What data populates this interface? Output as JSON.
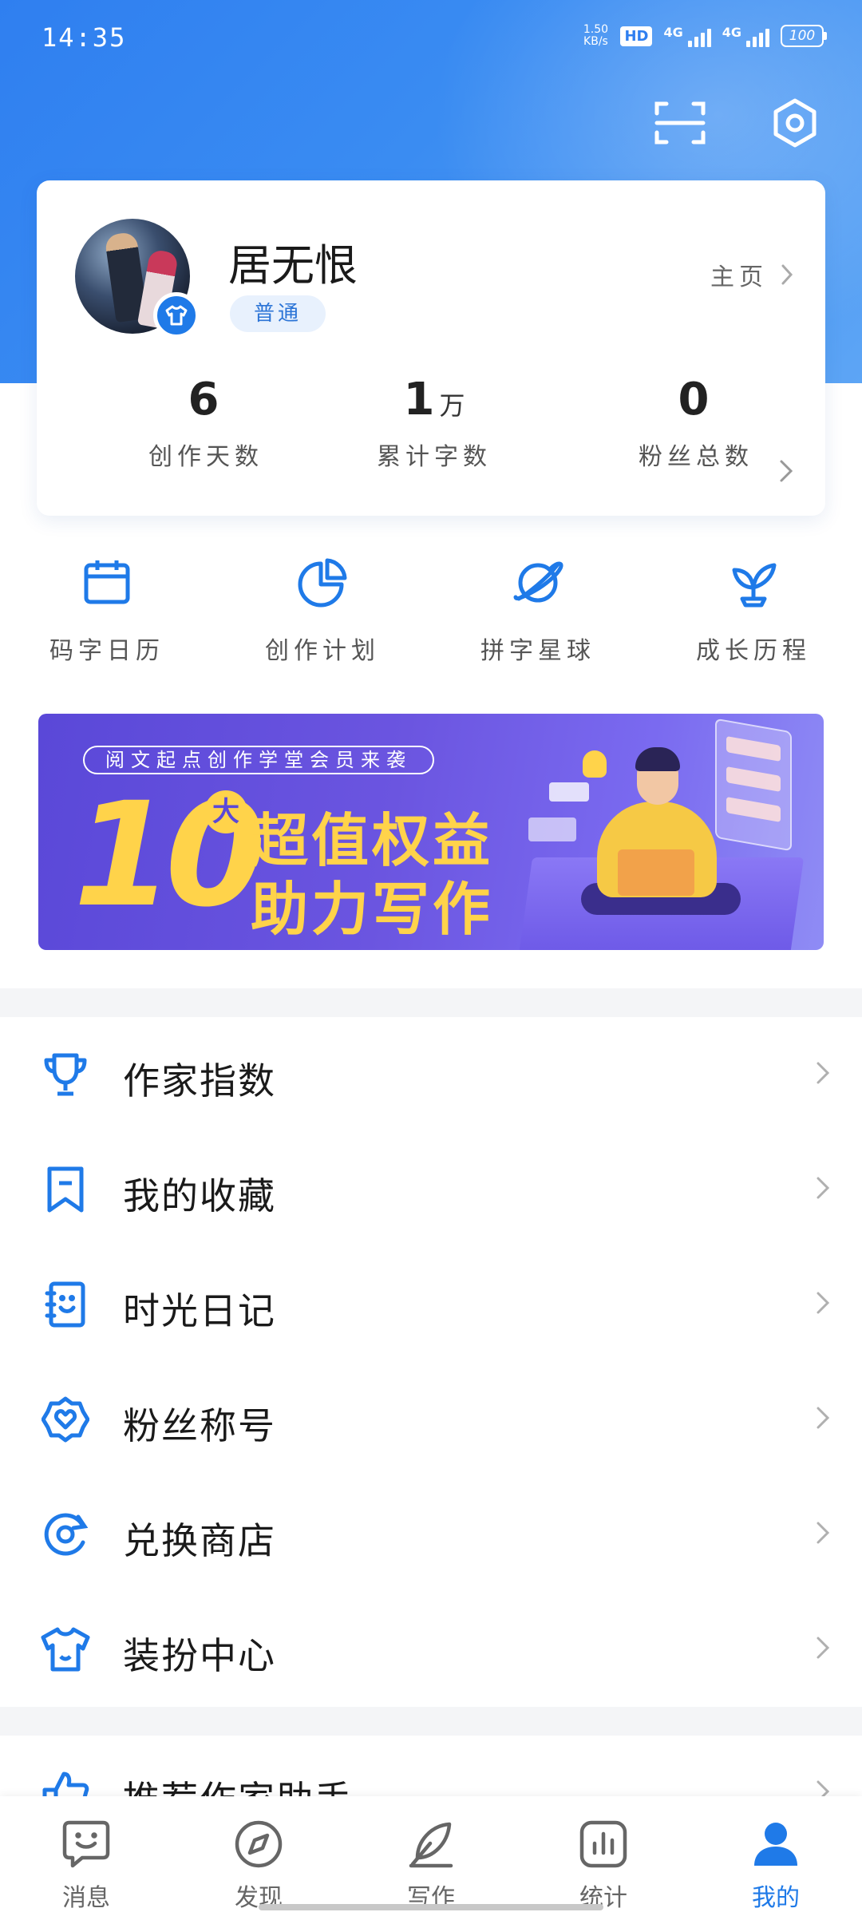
{
  "status_bar": {
    "time": "14:35",
    "net_speed_value": "1.50",
    "net_speed_unit": "KB/s",
    "hd_label": "HD",
    "sim1_label": "4G",
    "sim2_label": "4G",
    "battery": "100"
  },
  "header": {
    "icons": [
      "scan-icon",
      "settings-icon"
    ]
  },
  "profile": {
    "username": "居无恨",
    "level": "普通",
    "homepage_label": "主页",
    "stats": [
      {
        "value": "6",
        "unit": "",
        "label": "创作天数"
      },
      {
        "value": "1",
        "unit": "万",
        "label": "累计字数"
      },
      {
        "value": "0",
        "unit": "",
        "label": "粉丝总数"
      }
    ]
  },
  "quick_actions": [
    {
      "label": "码字日历",
      "icon": "calendar-icon"
    },
    {
      "label": "创作计划",
      "icon": "pie-chart-icon"
    },
    {
      "label": "拼字星球",
      "icon": "planet-icon"
    },
    {
      "label": "成长历程",
      "icon": "sprout-icon"
    }
  ],
  "banner": {
    "pill_text": "阅文起点创作学堂会员来袭",
    "big_number": "10",
    "big_badge": "大",
    "line1": "超值权益",
    "line2": "助力写作"
  },
  "menu": [
    {
      "label": "作家指数",
      "icon": "trophy-icon"
    },
    {
      "label": "我的收藏",
      "icon": "bookmark-icon"
    },
    {
      "label": "时光日记",
      "icon": "diary-icon"
    },
    {
      "label": "粉丝称号",
      "icon": "badge-heart-icon"
    },
    {
      "label": "兑换商店",
      "icon": "exchange-icon"
    },
    {
      "label": "装扮中心",
      "icon": "tshirt-icon"
    },
    {
      "label": "推荐作家助手",
      "icon": "thumbs-up-icon"
    }
  ],
  "bottom_nav": [
    {
      "label": "消息",
      "icon": "message-icon",
      "active": false
    },
    {
      "label": "发现",
      "icon": "compass-icon",
      "active": false
    },
    {
      "label": "写作",
      "icon": "feather-icon",
      "active": false
    },
    {
      "label": "统计",
      "icon": "bar-chart-icon",
      "active": false
    },
    {
      "label": "我的",
      "icon": "user-icon",
      "active": true
    }
  ],
  "colors": {
    "brand_blue": "#1f7ae8",
    "header_gradient_start": "#2f7ff0",
    "banner_yellow": "#ffd34a",
    "banner_purple": "#5a48d8"
  }
}
